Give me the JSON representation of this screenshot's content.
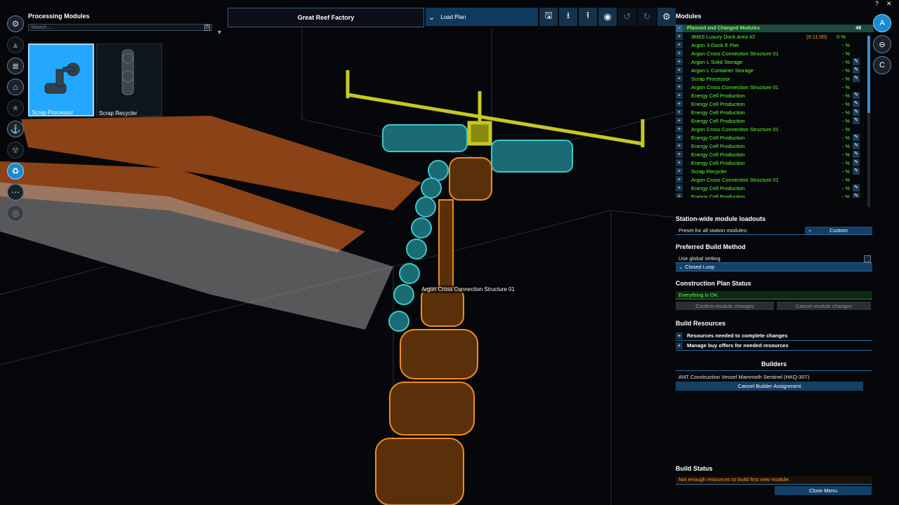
{
  "top_controls": {
    "help": "?",
    "close": "✕"
  },
  "left_panel": {
    "title": "Processing Modules",
    "search_placeholder": "Search...",
    "search_count": "0",
    "cards": [
      {
        "label": "Scrap Processor",
        "selected": true
      },
      {
        "label": "Scrap Recycler",
        "selected": false
      }
    ]
  },
  "left_rail": [
    "gear-cluster-icon",
    "triangle-icon",
    "storage-icon",
    "home-icon",
    "star-icon",
    "anchor-icon",
    "radiation-icon",
    "recycle-icon",
    "more-icon",
    "ring-icon"
  ],
  "toolbar": {
    "station_name": "Great Reef Factory",
    "load_plan": "Load Plan",
    "buttons": [
      "save-icon",
      "import-icon",
      "export-icon",
      "view-icon",
      "undo-icon",
      "redo-icon",
      "settings-icon"
    ]
  },
  "tooltip": "Argon Cross Connection Structure 01",
  "modules": {
    "title": "Modules",
    "group": {
      "label": "Planned and Changed Modules",
      "count": "49"
    },
    "rows": [
      {
        "name": "3M6S Luxury Dock Area #2",
        "time": "(0:11:00)",
        "pct": "0 %",
        "edit": false,
        "warn": true
      },
      {
        "name": "Argon 3-Dock E Pier",
        "pct": "- %",
        "edit": false
      },
      {
        "name": "Argon Cross Connection Structure 01",
        "pct": "- %",
        "edit": false
      },
      {
        "name": "Argon L Solid Storage",
        "pct": "- %",
        "edit": true
      },
      {
        "name": "Argon L Container Storage",
        "pct": "- %",
        "edit": true
      },
      {
        "name": "Scrap Processor",
        "pct": "- %",
        "edit": true
      },
      {
        "name": "Argon Cross Connection Structure 01",
        "pct": "- %",
        "edit": false
      },
      {
        "name": "Energy Cell Production",
        "pct": "- %",
        "edit": true
      },
      {
        "name": "Energy Cell Production",
        "pct": "- %",
        "edit": true
      },
      {
        "name": "Energy Cell Production",
        "pct": "- %",
        "edit": true
      },
      {
        "name": "Energy Cell Production",
        "pct": "- %",
        "edit": true
      },
      {
        "name": "Argon Cross Connection Structure 01",
        "pct": "- %",
        "edit": false
      },
      {
        "name": "Energy Cell Production",
        "pct": "- %",
        "edit": true
      },
      {
        "name": "Energy Cell Production",
        "pct": "- %",
        "edit": true
      },
      {
        "name": "Energy Cell Production",
        "pct": "- %",
        "edit": true
      },
      {
        "name": "Energy Cell Production",
        "pct": "- %",
        "edit": true
      },
      {
        "name": "Scrap Recycler",
        "pct": "- %",
        "edit": true
      },
      {
        "name": "Argon Cross Connection Structure 01",
        "pct": "- %",
        "edit": false
      },
      {
        "name": "Energy Cell Production",
        "pct": "- %",
        "edit": true
      },
      {
        "name": "Energy Cell Production",
        "pct": "- %",
        "edit": true
      }
    ]
  },
  "loadouts": {
    "title": "Station-wide module loadouts",
    "preset_label": "Preset for all station modules:",
    "preset_value": "Custom"
  },
  "build_method": {
    "title": "Preferred Build Method",
    "use_global": "Use global setting",
    "method": "Closed Loop"
  },
  "plan_status": {
    "title": "Construction Plan Status",
    "status": "Everything is OK.",
    "confirm": "Confirm module changes",
    "cancel": "Cancel module changes"
  },
  "resources": {
    "title": "Build Resources",
    "item1": "Resources needed to complete changes",
    "item2": "Manage buy offers for needed resources"
  },
  "builders": {
    "title": "Builders",
    "builder": "ANT Construction Vessel Mammoth Sentinel (HKQ-307)",
    "cancel": "Cancel Builder Assignment"
  },
  "build_status": {
    "title": "Build Status",
    "message": "Not enough resources to build first new module.",
    "close": "Close Menu"
  },
  "right_rail": [
    "A",
    "connection-icon",
    "C"
  ],
  "colors": {
    "accent": "#1a8bd0",
    "ok_green": "#5fff2e",
    "warn_orange": "#ff9a2e",
    "yellow_structure": "#c8c820",
    "teal_structure": "#3ec8c8",
    "orange_structure": "#f08c1e"
  }
}
